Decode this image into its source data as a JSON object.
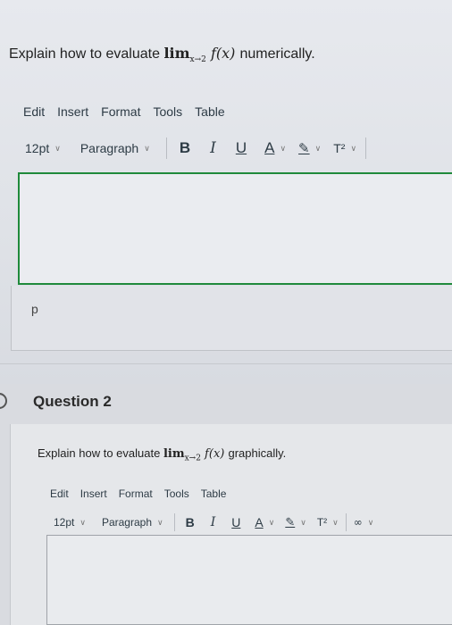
{
  "question1": {
    "prompt_prefix": "Explain how to evaluate ",
    "lim": "lim",
    "lim_sub": "x→2",
    "func": " f(x) ",
    "prompt_suffix": "numerically.",
    "menu": [
      "Edit",
      "Insert",
      "Format",
      "Tools",
      "Table"
    ],
    "font_size": "12pt",
    "block_format": "Paragraph",
    "bold": "B",
    "italic": "I",
    "underline": "U",
    "text_color": "A",
    "highlight": "✎",
    "superscript": "T²",
    "status_path": "p"
  },
  "question2": {
    "title": "Question 2",
    "prompt_prefix": "Explain how to evaluate ",
    "lim": "lim",
    "lim_sub": "x→2",
    "func": " f(x) ",
    "prompt_suffix": "graphically.",
    "menu": [
      "Edit",
      "Insert",
      "Format",
      "Tools",
      "Table"
    ],
    "font_size": "12pt",
    "block_format": "Paragraph",
    "bold": "B",
    "italic": "I",
    "underline": "U",
    "text_color": "A",
    "highlight": "✎",
    "superscript": "T²",
    "link_icon": "🔗"
  },
  "colors": {
    "focus_border": "#1f8a3b",
    "text": "#2d3b45"
  }
}
